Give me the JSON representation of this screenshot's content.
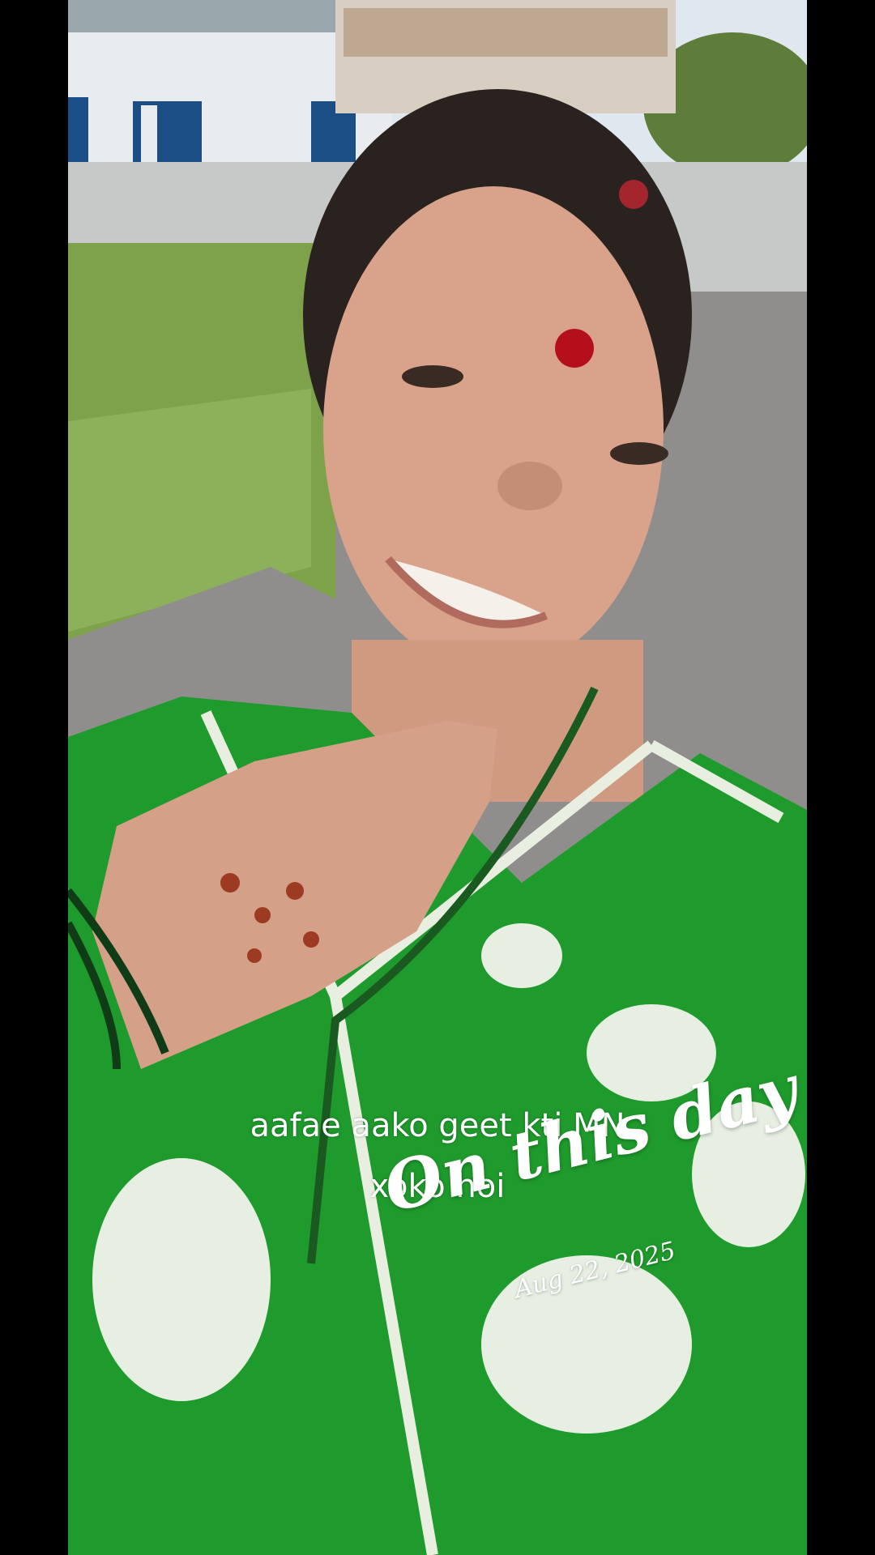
{
  "caption": {
    "line1": "aafae aako geet kti MN",
    "line2": "xoko hoi"
  },
  "memory_overlay": {
    "title": "On this day",
    "date": "Aug 22, 2025"
  },
  "colors": {
    "letterbox": "#000000",
    "dress_green": "#1f9a2c",
    "road_grey": "#8f8e8c",
    "grass_green": "#7ea24a",
    "sky": "#dfe8ee"
  }
}
